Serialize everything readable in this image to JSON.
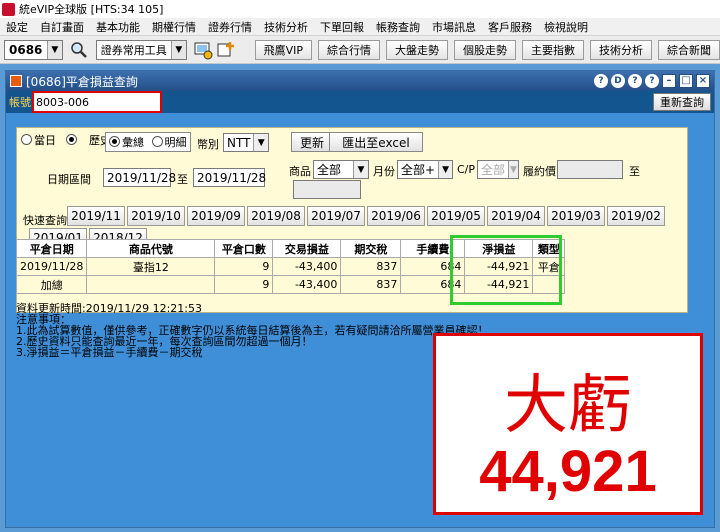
{
  "app": {
    "title": "統eVIP全球版  [HTS:34 105]"
  },
  "menu": [
    "設定",
    "自訂畫面",
    "基本功能",
    "期權行情",
    "證券行情",
    "技術分析",
    "下單回報",
    "帳務查詢",
    "市場訊息",
    "客戶服務",
    "檢視說明"
  ],
  "toolbar": {
    "symbol": "0686",
    "tools_select": "證券常用工具",
    "buttons": [
      "飛鷹VIP",
      "綜合行情",
      "大盤走勢",
      "個股走勢",
      "主要指數",
      "技術分析",
      "綜合新聞"
    ]
  },
  "window": {
    "title": "[0686]平倉損益查詢",
    "controls": [
      "?",
      "D",
      "?",
      "?"
    ],
    "account_label": "帳號",
    "account_value": "8003-006",
    "requery_button": "重新查詢"
  },
  "query": {
    "radio_today": "當日",
    "radio_history": "歷史",
    "radio_total": "彙總",
    "radio_detail": "明細",
    "currency_label": "幣別",
    "currency_value": "NTT",
    "refresh_button": "更新",
    "export_button": "匯出至excel",
    "product_label": "商品",
    "product_value": "全部",
    "month_label": "月份",
    "month_value": "全部+",
    "cp_label": "C/P",
    "cp_value": "全部",
    "strike_label": "履約價",
    "to_label": "至",
    "date_label": "日期區間",
    "date_from": "2019/11/28",
    "date_to": "2019/11/28",
    "quick_label": "快速查詢",
    "months": [
      "2019/11",
      "2019/10",
      "2019/09",
      "2019/08",
      "2019/07",
      "2019/06",
      "2019/05",
      "2019/04",
      "2019/03",
      "2019/02",
      "2019/01",
      "2018/12"
    ]
  },
  "table": {
    "headers": [
      "平倉日期",
      "商品代號",
      "平倉口數",
      "交易損益",
      "期交稅",
      "手續費",
      "淨損益",
      "類型"
    ],
    "rows": [
      [
        "2019/11/28",
        "臺指12",
        "9",
        "-43,400",
        "837",
        "684",
        "-44,921",
        "平倉"
      ],
      [
        "加總",
        "",
        "9",
        "-43,400",
        "837",
        "684",
        "-44,921",
        ""
      ]
    ]
  },
  "notes": {
    "updated": "資料更新時間:2019/11/29 12:21:53",
    "title": " 注意事項：",
    "lines": [
      "1.此為試算數值，僅供參考，正確數字仍以系統每日結算後為主，若有疑問請洽所屬營業員確認！",
      "2.歷史資料只能查詢最近一年，每次查詢區間勿超過一個月！",
      "3.淨損益＝平倉損益－手續費－期交稅"
    ]
  },
  "annotation": {
    "line1": "大虧",
    "line2": "44,921"
  },
  "colors": {
    "accent_red": "#e00000",
    "highlight_green": "#2ecc2e",
    "panel_bg": "#fffbd6",
    "window_bg": "#3f8fd8"
  }
}
